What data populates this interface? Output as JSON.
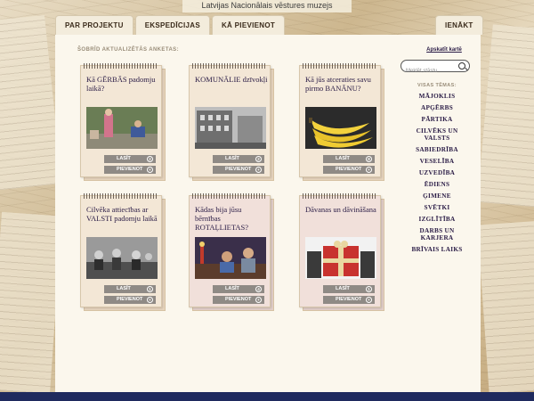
{
  "header": {
    "museum_title": "Latvijas Nacionālais vēstures muzejs"
  },
  "tabs": [
    {
      "label": "PAR PROJEKTU"
    },
    {
      "label": "EKSPEDĪCIJAS"
    },
    {
      "label": "KĀ PIEVIENOT"
    }
  ],
  "login_tab": {
    "label": "IENĀKT"
  },
  "main": {
    "section_label": "ŠOBRĪD AKTUALIZĒTĀS ANKETAS:"
  },
  "cards": [
    {
      "title": "Kā GĒRBĀS padomju laikā?",
      "read_label": "LASĪT",
      "read_count": "2",
      "add_label": "PIEVIENOT"
    },
    {
      "title": "KOMUNĀLIE dzīvokļi",
      "read_label": "LASĪT",
      "read_count": "2",
      "add_label": "PIEVIENOT"
    },
    {
      "title": "Kā jūs atceraties savu pirmo BANĀNU?",
      "read_label": "LASĪT",
      "read_count": "8",
      "add_label": "PIEVIENOT"
    },
    {
      "title": "Cilvēka attiecības ar VALSTI padomju laikā",
      "read_label": "LASĪT",
      "read_count": "1",
      "add_label": "PIEVIENOT"
    },
    {
      "title": "Kādas bija jūsu bērnības ROTAĻLIETAS?",
      "read_label": "LASĪT",
      "read_count": "4",
      "add_label": "PIEVIENOT"
    },
    {
      "title": "Dāvanas un dāvināšana",
      "read_label": "LASĪT",
      "read_count": "1",
      "add_label": "PIEVIENOT"
    }
  ],
  "sidebar": {
    "map_link": "Apskatīt kartē",
    "search_placeholder": "Meklēt stāstu",
    "topics_label": "VISAS TĒMAS:",
    "topics": [
      "MĀJOKLIS",
      "APĢĒRBS",
      "PĀRTIKA",
      "CILVĒKS UN VALSTS",
      "SABIEDRĪBA",
      "VESELĪBA",
      "UZVEDĪBA",
      "ĒDIENS",
      "ĢIMENE",
      "SVĒTKI",
      "IZGLĪTĪBA",
      "DARBS UN KARJERA",
      "BRĪVAIS LAIKS"
    ]
  },
  "colors": {
    "accent": "#2a1c46",
    "button": "#8f8a85",
    "footer": "#1f2a5e"
  }
}
